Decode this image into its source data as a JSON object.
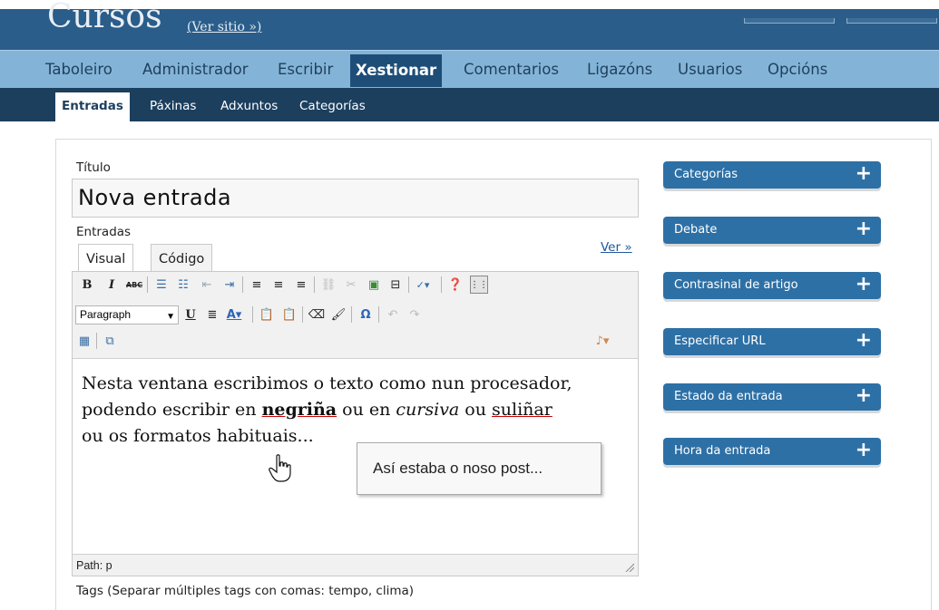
{
  "header": {
    "site_title": "Cursos",
    "view_site": "(Ver sitio »)"
  },
  "main_nav": [
    {
      "label": "Taboleiro"
    },
    {
      "label": "Administrador"
    },
    {
      "label": "Escribir"
    },
    {
      "label": "Xestionar",
      "active": true
    },
    {
      "label": "Comentarios"
    },
    {
      "label": "Ligazóns"
    },
    {
      "label": "Usuarios"
    },
    {
      "label": "Opcións"
    }
  ],
  "sub_nav": [
    {
      "label": "Entradas",
      "active": true
    },
    {
      "label": "Páxinas"
    },
    {
      "label": "Adxuntos"
    },
    {
      "label": "Categorías"
    }
  ],
  "form": {
    "title_label": "Título",
    "title_value": "Nova entrada",
    "entries_label": "Entradas",
    "tab_visual": "Visual",
    "tab_code": "Código",
    "view_link": "Ver »",
    "format_select": "Paragraph",
    "content": {
      "line1": "Nesta ventana escribimos o texto como nun procesador,",
      "line2_pre": "podendo escribir en ",
      "bold_word": "negriña",
      "line2_mid": " ou en ",
      "italic_word": "cursiva",
      "line2_mid2": " ou ",
      "underline_word": "suliñar",
      "line3": "ou os formatos habituais..."
    },
    "status_path": "Path: p",
    "tags_label": "Tags (Separar múltiples tags con comas: tempo, clima)"
  },
  "tooltip": "Así estaba o noso post...",
  "side_panels": [
    {
      "label": "Categorías"
    },
    {
      "label": "Debate"
    },
    {
      "label": "Contrasinal de artigo"
    },
    {
      "label": "Especificar URL"
    },
    {
      "label": "Estado da entrada"
    },
    {
      "label": "Hora da entrada"
    }
  ],
  "colors": {
    "header_bg": "#2a5d8a",
    "nav_bg": "#83b4d8",
    "subnav_bg": "#1c3f5e",
    "panel_bg": "#2d70a6"
  }
}
